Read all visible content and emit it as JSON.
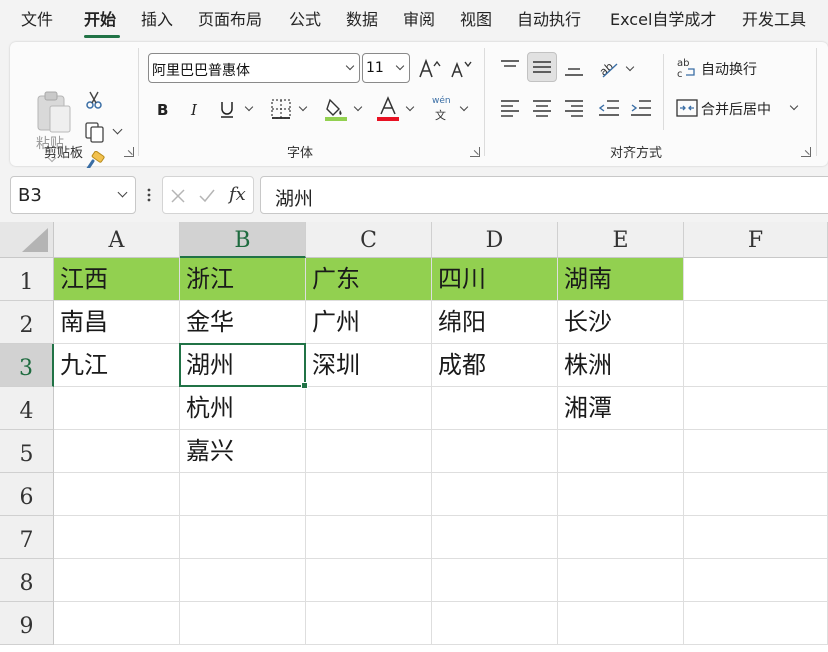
{
  "menu": {
    "tabs": [
      "文件",
      "开始",
      "插入",
      "页面布局",
      "公式",
      "数据",
      "审阅",
      "视图",
      "自动执行",
      "Excel自学成才",
      "开发工具"
    ],
    "active_tab": "开始"
  },
  "ribbon": {
    "clipboard": {
      "paste_label": "粘贴",
      "group_label": "剪贴板"
    },
    "font": {
      "font_name": "阿里巴巴普惠体",
      "font_size": "11",
      "group_label": "字体",
      "phonetic_label": "wén",
      "phonetic_char": "文"
    },
    "alignment": {
      "wrap_text_label": "自动换行",
      "merge_center_label": "合并后居中",
      "group_label": "对齐方式"
    }
  },
  "formula_bar": {
    "name_box": "B3",
    "fx_label": "fx",
    "content": "湖州"
  },
  "sheet": {
    "columns": [
      "A",
      "B",
      "C",
      "D",
      "E",
      "F"
    ],
    "rows": [
      "1",
      "2",
      "3",
      "4",
      "5",
      "6",
      "7",
      "8",
      "9"
    ],
    "selected_cell": "B3",
    "header_fill_color": "#92d050",
    "selection_color": "#217346",
    "cells": [
      [
        "江西",
        "浙江",
        "广东",
        "四川",
        "湖南",
        ""
      ],
      [
        "南昌",
        "金华",
        "广州",
        "绵阳",
        "长沙",
        ""
      ],
      [
        "九江",
        "湖州",
        "深圳",
        "成都",
        "株洲",
        ""
      ],
      [
        "",
        "杭州",
        "",
        "",
        "湘潭",
        ""
      ],
      [
        "",
        "嘉兴",
        "",
        "",
        "",
        ""
      ],
      [
        "",
        "",
        "",
        "",
        "",
        ""
      ],
      [
        "",
        "",
        "",
        "",
        "",
        ""
      ],
      [
        "",
        "",
        "",
        "",
        "",
        ""
      ],
      [
        "",
        "",
        "",
        "",
        "",
        ""
      ]
    ]
  }
}
